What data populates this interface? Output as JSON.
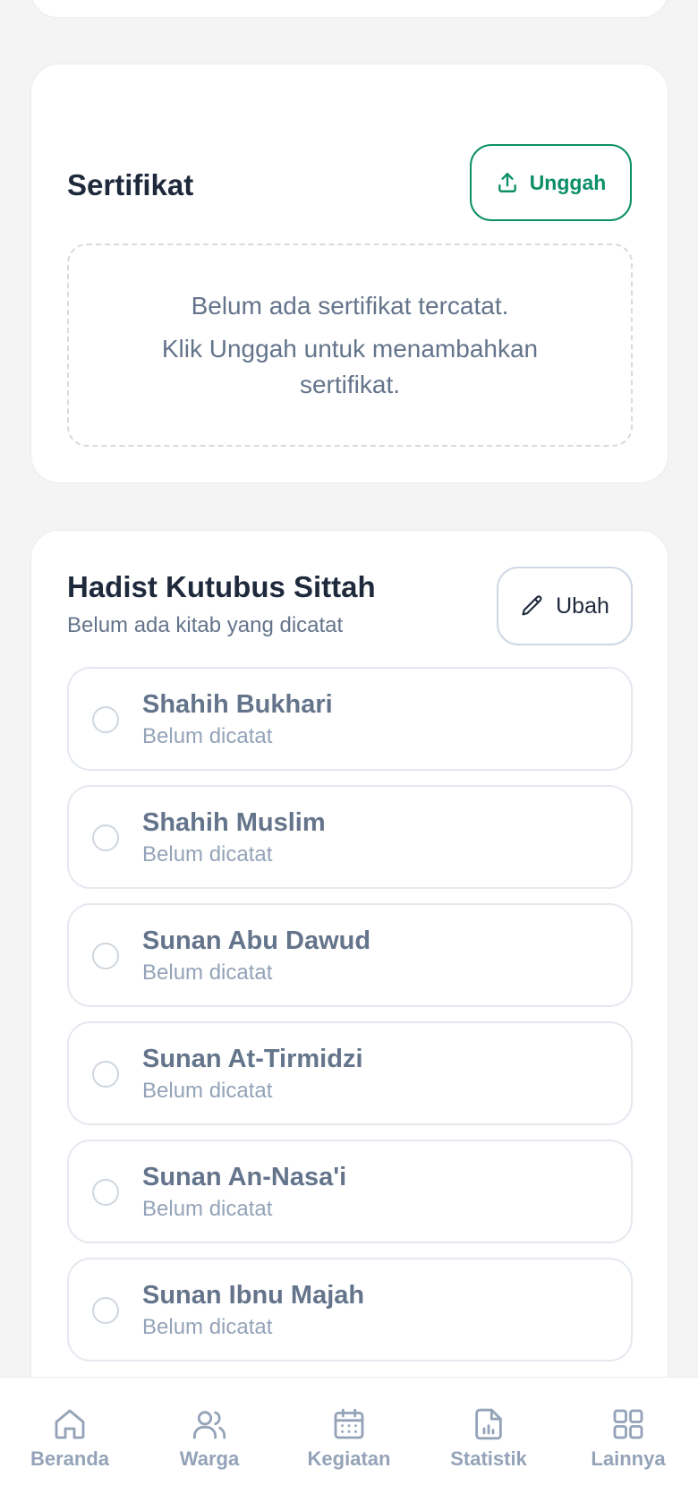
{
  "certificate": {
    "title": "Sertifikat",
    "upload_label": "Unggah",
    "empty_line1": "Belum ada sertifikat tercatat.",
    "empty_line2": "Klik Unggah untuk menambahkan sertifikat."
  },
  "hadist": {
    "title": "Hadist Kutubus Sittah",
    "subtitle": "Belum ada kitab yang dicatat",
    "edit_label": "Ubah",
    "items": [
      {
        "name": "Shahih Bukhari",
        "status": "Belum dicatat"
      },
      {
        "name": "Shahih Muslim",
        "status": "Belum dicatat"
      },
      {
        "name": "Sunan Abu Dawud",
        "status": "Belum dicatat"
      },
      {
        "name": "Sunan At-Tirmidzi",
        "status": "Belum dicatat"
      },
      {
        "name": "Sunan An-Nasa'i",
        "status": "Belum dicatat"
      },
      {
        "name": "Sunan Ibnu Majah",
        "status": "Belum dicatat"
      }
    ]
  },
  "nav": {
    "items": [
      {
        "label": "Beranda",
        "icon": "home-icon"
      },
      {
        "label": "Warga",
        "icon": "users-icon"
      },
      {
        "label": "Kegiatan",
        "icon": "calendar-icon"
      },
      {
        "label": "Statistik",
        "icon": "chart-file-icon"
      },
      {
        "label": "Lainnya",
        "icon": "grid-icon"
      }
    ]
  },
  "colors": {
    "accent": "#0c8f67",
    "muted_text": "#64748b",
    "light_text": "#94a3b8",
    "background": "#f4f4f5"
  }
}
